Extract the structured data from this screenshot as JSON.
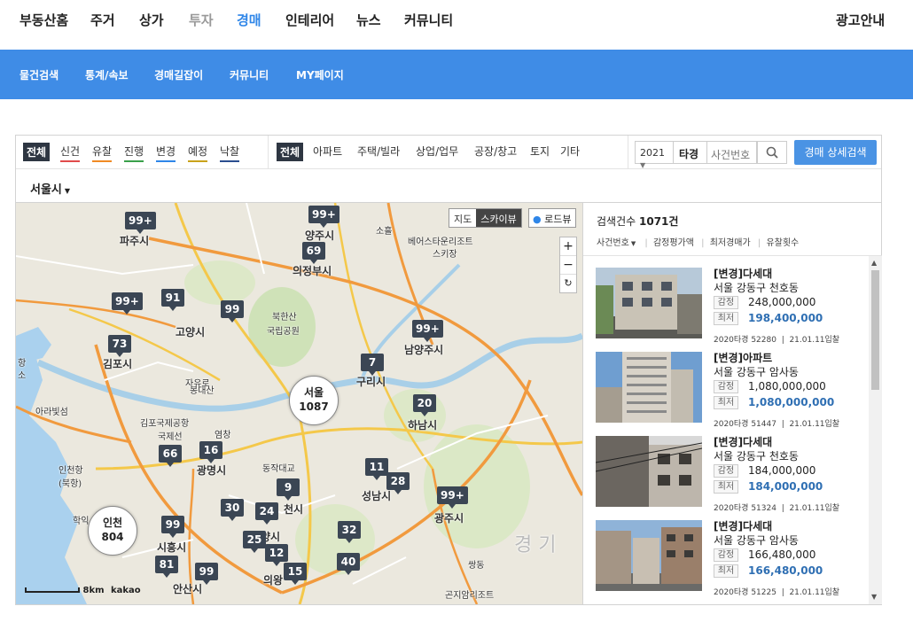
{
  "top_nav": {
    "items": [
      "부동산홈",
      "주거",
      "상가",
      "투자",
      "경매",
      "인테리어",
      "뉴스",
      "커뮤니티"
    ],
    "right": "광고안내",
    "active": "경매"
  },
  "sub_nav": {
    "items": [
      "물건검색",
      "통계/속보",
      "경매길잡이",
      "커뮤니티",
      "MY페이지"
    ]
  },
  "filters": {
    "status_all": "전체",
    "status": [
      {
        "label": "신건",
        "color": "#e04b4b"
      },
      {
        "label": "유찰",
        "color": "#f08a24"
      },
      {
        "label": "진행",
        "color": "#3aa04a"
      },
      {
        "label": "변경",
        "color": "#2f86e8"
      },
      {
        "label": "예정",
        "color": "#c9a21a"
      },
      {
        "label": "낙찰",
        "color": "#2a4d8f"
      }
    ],
    "type_all": "전체",
    "types": [
      "아파트",
      "주택/빌라",
      "상업/업무",
      "공장/창고",
      "토지",
      "기타"
    ],
    "year": "2021",
    "court_prefix": "타경",
    "case_placeholder": "사건번호",
    "detail_search": "경매 상세검색",
    "region": "서울시"
  },
  "map": {
    "controls": {
      "map": "지도",
      "skyview": "스카이뷰",
      "roadview": "로드뷰",
      "zoom_in": "+",
      "zoom_out": "−",
      "reset": "↻"
    },
    "scale": "8km",
    "provider": "kakao",
    "markers": [
      {
        "label": "99+"
      },
      {
        "label": "99+"
      },
      {
        "label": "69"
      },
      {
        "label": "91"
      },
      {
        "label": "99+"
      },
      {
        "label": "99"
      },
      {
        "label": "73"
      },
      {
        "label": "99+"
      },
      {
        "label": "7"
      },
      {
        "label": "20"
      },
      {
        "label": "66"
      },
      {
        "label": "16"
      },
      {
        "label": "11"
      },
      {
        "label": "28"
      },
      {
        "label": "9"
      },
      {
        "label": "99+"
      },
      {
        "label": "30"
      },
      {
        "label": "24"
      },
      {
        "label": "99"
      },
      {
        "label": "32"
      },
      {
        "label": "25"
      },
      {
        "label": "12"
      },
      {
        "label": "81"
      },
      {
        "label": "99"
      },
      {
        "label": "40"
      },
      {
        "label": "15"
      }
    ],
    "clusters": [
      {
        "name": "서울",
        "count": "1087"
      },
      {
        "name": "인천",
        "count": "804"
      }
    ],
    "places": [
      "파주시",
      "양주시",
      "의정부시",
      "베어스타운리조트",
      "스키장",
      "북한산",
      "국립공원",
      "고양시",
      "남양주시",
      "김포시",
      "구리시",
      "하남시",
      "김포국제공항",
      "국제선",
      "광명시",
      "성남시",
      "광주시",
      "인천항",
      "(북항)",
      "시흥시",
      "안산시",
      "의왕",
      "곤지암리조트",
      "경 기",
      "자유로",
      "봉대산",
      "동작대교",
      "소흘",
      "쌍동",
      "학익",
      "천시",
      "양시",
      "아라빛섬",
      "염창",
      "항",
      "소"
    ]
  },
  "results": {
    "count_label": "검색건수",
    "count": "1071건",
    "sort": [
      "사건번호",
      "감정평가액",
      "최저경매가",
      "유찰횟수"
    ],
    "appraisal_label": "감정",
    "min_label": "최저",
    "items": [
      {
        "title": "[변경]다세대",
        "addr": "서울 강동구 천호동",
        "appraisal": "248,000,000",
        "min": "198,400,000",
        "case": "2020타경 52280",
        "date": "21.01.11입찰"
      },
      {
        "title": "[변경]아파트",
        "addr": "서울 강동구 암사동",
        "appraisal": "1,080,000,000",
        "min": "1,080,000,000",
        "case": "2020타경 51447",
        "date": "21.01.11입찰"
      },
      {
        "title": "[변경]다세대",
        "addr": "서울 강동구 천호동",
        "appraisal": "184,000,000",
        "min": "184,000,000",
        "case": "2020타경 51324",
        "date": "21.01.11입찰"
      },
      {
        "title": "[변경]다세대",
        "addr": "서울 강동구 암사동",
        "appraisal": "166,480,000",
        "min": "166,480,000",
        "case": "2020타경 51225",
        "date": "21.01.11입찰"
      }
    ]
  }
}
